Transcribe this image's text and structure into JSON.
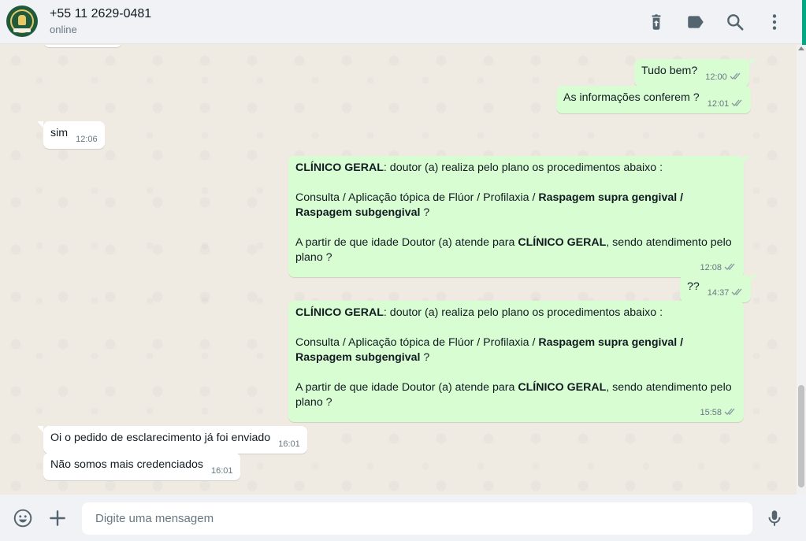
{
  "header": {
    "contact_name": "+55 11 2629-0481",
    "status": "online",
    "icons": [
      "delete-icon",
      "label-icon",
      "search-icon",
      "menu-icon"
    ]
  },
  "messages": [
    {
      "dir": "out",
      "text": "Tudo bem?",
      "time": "12:00",
      "status": "read"
    },
    {
      "dir": "out",
      "text": "As informações conferem ?",
      "time": "12:01",
      "status": "read"
    },
    {
      "dir": "in",
      "text": "sim",
      "time": "12:06"
    },
    {
      "dir": "out",
      "time": "12:08",
      "status": "read",
      "p1_bold": "CLÍNICO GERAL",
      "p1_rest": ":  doutor (a) realiza pelo plano os procedimentos abaixo :",
      "p2_plain": "Consulta /  Aplicação tópica de Flúor  /  Profilaxia / ",
      "p2_bold": "Raspagem supra gengival / Raspagem subgengival",
      "p2_end": " ?",
      "p3_plain": " A partir de que idade Doutor (a) atende para ",
      "p3_bold": "CLÍNICO GERAL",
      "p3_end": ", sendo atendimento pelo plano ?"
    },
    {
      "dir": "out",
      "text": "??",
      "time": "14:37",
      "status": "read"
    },
    {
      "dir": "out",
      "time": "15:58",
      "status": "read",
      "p1_bold": "CLÍNICO GERAL",
      "p1_rest": ":  doutor (a) realiza pelo plano os procedimentos abaixo :",
      "p2_plain": "Consulta /  Aplicação tópica de Flúor  /  Profilaxia / ",
      "p2_bold": "Raspagem supra gengival / Raspagem subgengival",
      "p2_end": " ?",
      "p3_plain": " A partir de que idade Doutor (a) atende para ",
      "p3_bold": "CLÍNICO GERAL",
      "p3_end": ", sendo atendimento pelo plano ?"
    },
    {
      "dir": "in",
      "text": "Oi o pedido de esclarecimento já foi enviado",
      "time": "16:01"
    },
    {
      "dir": "in",
      "text": "Não somos mais credenciados",
      "time": "16:01"
    }
  ],
  "composer": {
    "placeholder": "Digite uma mensagem",
    "icons": [
      "emoji-icon",
      "attach-plus-icon",
      "microphone-icon"
    ]
  },
  "colors": {
    "outgoing_bubble": "#d9fdd3",
    "incoming_bubble": "#ffffff",
    "chat_background": "#efeae2",
    "read_ticks": "#8696a0",
    "accent": "#00a884"
  }
}
